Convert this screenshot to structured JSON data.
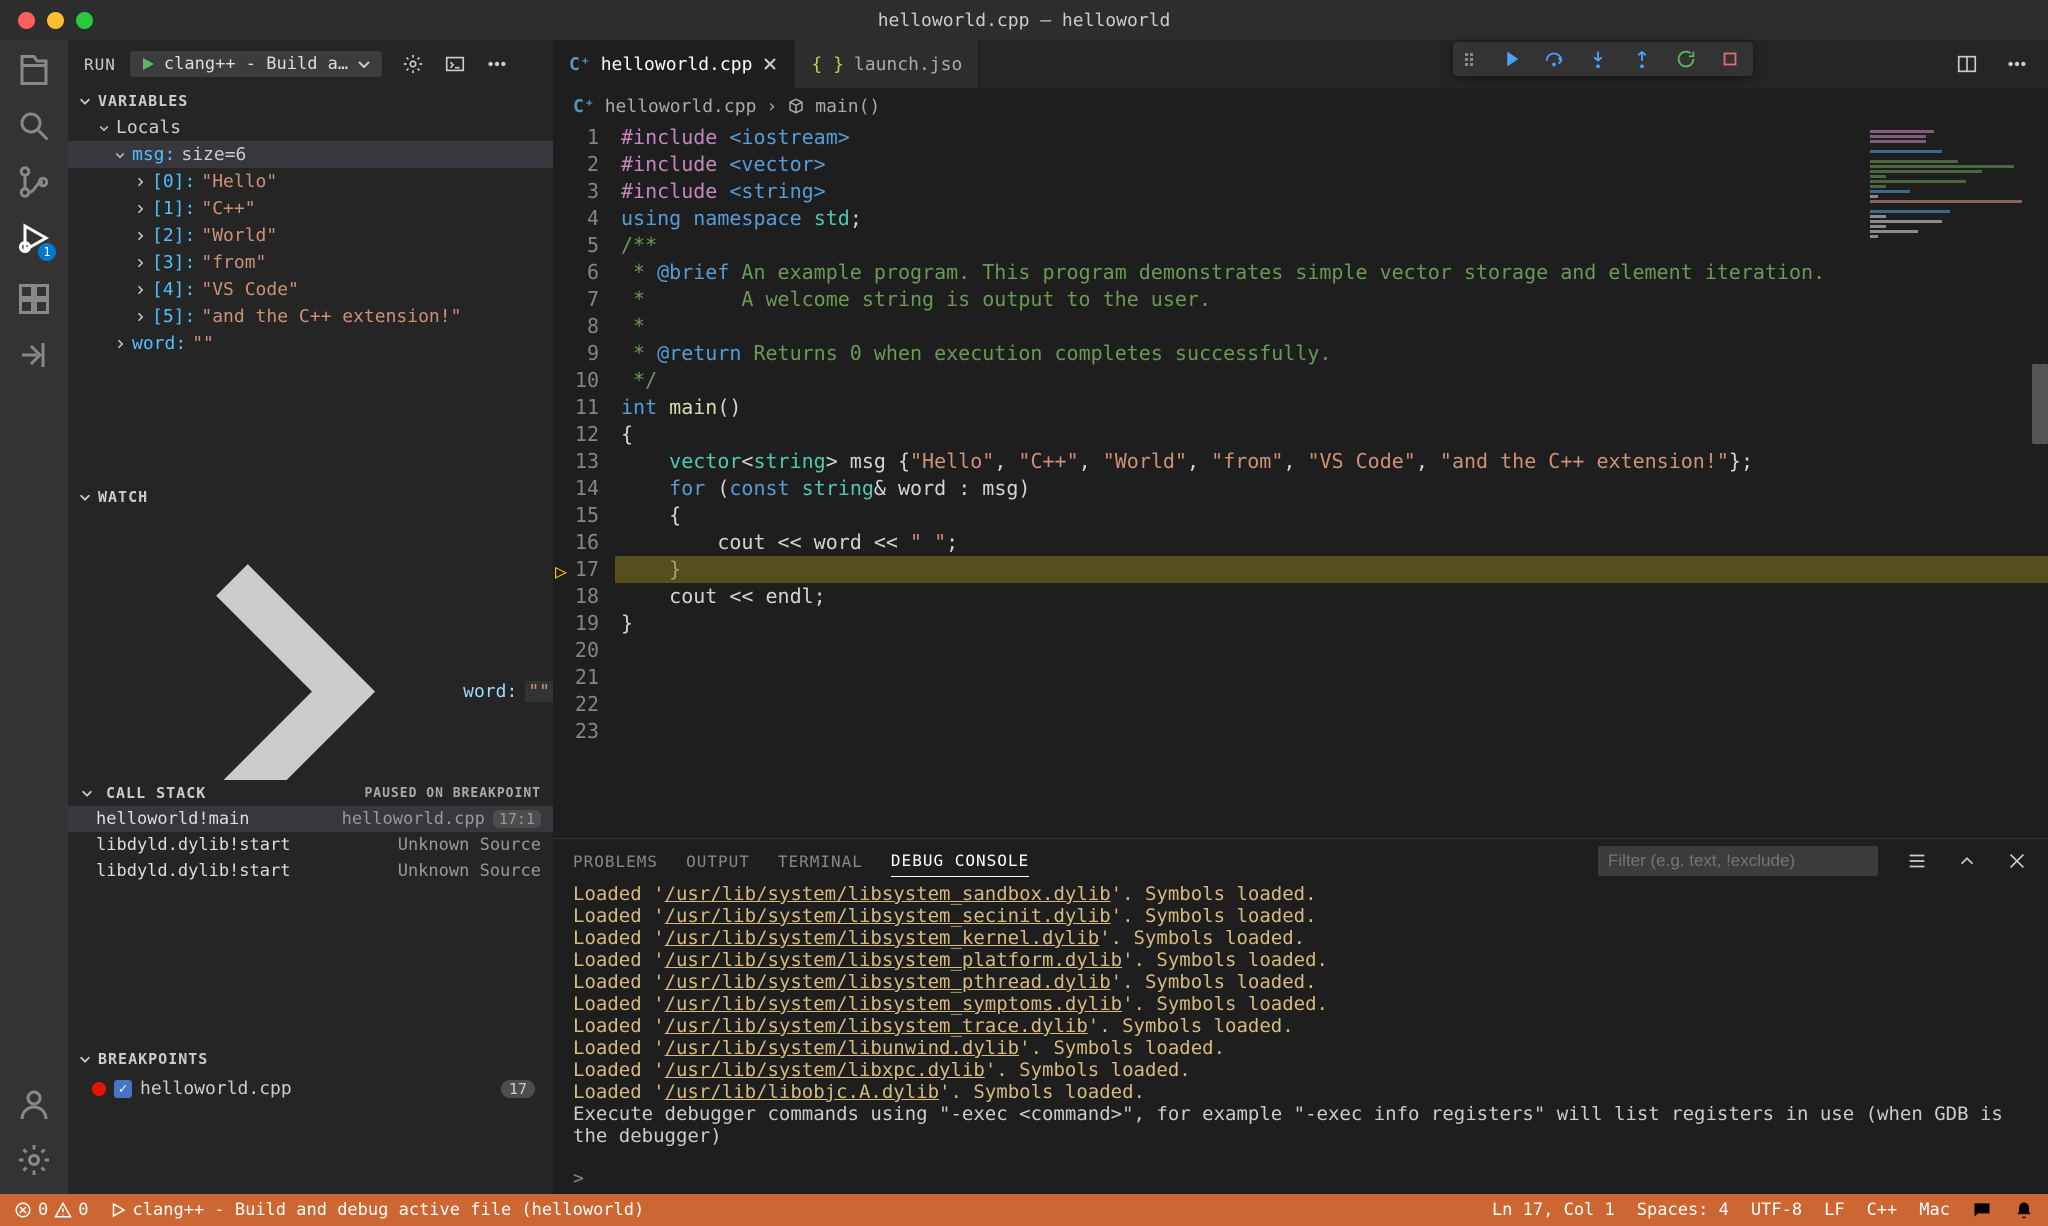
{
  "window": {
    "title": "helloworld.cpp — helloworld"
  },
  "sidebar": {
    "run_label": "RUN",
    "run_config": "clang++ - Build a…",
    "sections": {
      "variables": "VARIABLES",
      "locals": "Locals",
      "watch": "WATCH",
      "callstack": "CALL STACK",
      "callstack_status": "PAUSED ON BREAKPOINT",
      "breakpoints": "BREAKPOINTS"
    },
    "vars": {
      "msg_label": "msg:",
      "msg_size": "size=6",
      "items": [
        {
          "key": "[0]:",
          "val": "\"Hello\""
        },
        {
          "key": "[1]:",
          "val": "\"C++\""
        },
        {
          "key": "[2]:",
          "val": "\"World\""
        },
        {
          "key": "[3]:",
          "val": "\"from\""
        },
        {
          "key": "[4]:",
          "val": "\"VS Code\""
        },
        {
          "key": "[5]:",
          "val": "\"and the C++ extension!\""
        }
      ],
      "word_key": "word:",
      "word_val": "\"\""
    },
    "watch": {
      "word_key": "word:",
      "word_val": "\"\""
    },
    "stack": [
      {
        "fn": "helloworld!main",
        "src": "helloworld.cpp",
        "loc": "17:1"
      },
      {
        "fn": "libdyld.dylib!start",
        "src": "Unknown Source",
        "loc": ""
      },
      {
        "fn": "libdyld.dylib!start",
        "src": "Unknown Source",
        "loc": ""
      }
    ],
    "breakpoint": {
      "file": "helloworld.cpp",
      "line": "17"
    }
  },
  "tabs": {
    "active": "helloworld.cpp",
    "inactive": "launch.jso"
  },
  "breadcrumb": {
    "file": "helloworld.cpp",
    "symbol": "main()"
  },
  "code": {
    "lines": [
      "#include <iostream>",
      "#include <vector>",
      "#include <string>",
      "",
      "using namespace std;",
      "",
      "/**",
      " * @brief An example program. This program demonstrates simple vector storage and element iteration.",
      " *        A welcome string is output to the user.",
      " *",
      " * @return Returns 0 when execution completes successfully.",
      " */",
      "int main()",
      "{",
      "    vector<string> msg {\"Hello\", \"C++\", \"World\", \"from\", \"VS Code\", \"and the C++ extension!\"};",
      "",
      "    for (const string& word : msg)",
      "    {",
      "        cout << word << \" \";",
      "    }",
      "    cout << endl;",
      "}",
      ""
    ]
  },
  "panel": {
    "tabs": {
      "problems": "PROBLEMS",
      "output": "OUTPUT",
      "terminal": "TERMINAL",
      "debug_console": "DEBUG CONSOLE"
    },
    "filter_placeholder": "Filter (e.g. text, !exclude)",
    "console": [
      {
        "p": "Loaded '",
        "u": "/usr/lib/system/libsystem_sandbox.dylib",
        "s": "'. Symbols loaded."
      },
      {
        "p": "Loaded '",
        "u": "/usr/lib/system/libsystem_secinit.dylib",
        "s": "'. Symbols loaded."
      },
      {
        "p": "Loaded '",
        "u": "/usr/lib/system/libsystem_kernel.dylib",
        "s": "'. Symbols loaded."
      },
      {
        "p": "Loaded '",
        "u": "/usr/lib/system/libsystem_platform.dylib",
        "s": "'. Symbols loaded."
      },
      {
        "p": "Loaded '",
        "u": "/usr/lib/system/libsystem_pthread.dylib",
        "s": "'. Symbols loaded."
      },
      {
        "p": "Loaded '",
        "u": "/usr/lib/system/libsystem_symptoms.dylib",
        "s": "'. Symbols loaded."
      },
      {
        "p": "Loaded '",
        "u": "/usr/lib/system/libsystem_trace.dylib",
        "s": "'. Symbols loaded."
      },
      {
        "p": "Loaded '",
        "u": "/usr/lib/system/libunwind.dylib",
        "s": "'. Symbols loaded."
      },
      {
        "p": "Loaded '",
        "u": "/usr/lib/system/libxpc.dylib",
        "s": "'. Symbols loaded."
      },
      {
        "p": "Loaded '",
        "u": "/usr/lib/libobjc.A.dylib",
        "s": "'. Symbols loaded."
      }
    ],
    "console_tail": "Execute debugger commands using \"-exec <command>\", for example \"-exec info registers\" will list registers in use (when GDB is the debugger)",
    "prompt": ">"
  },
  "status": {
    "errors": "0",
    "warnings": "0",
    "task": "clang++ - Build and debug active file (helloworld)",
    "ln_col": "Ln 17, Col 1",
    "spaces": "Spaces: 4",
    "encoding": "UTF-8",
    "eol": "LF",
    "lang": "C++",
    "os": "Mac"
  },
  "activity_badge": "1"
}
